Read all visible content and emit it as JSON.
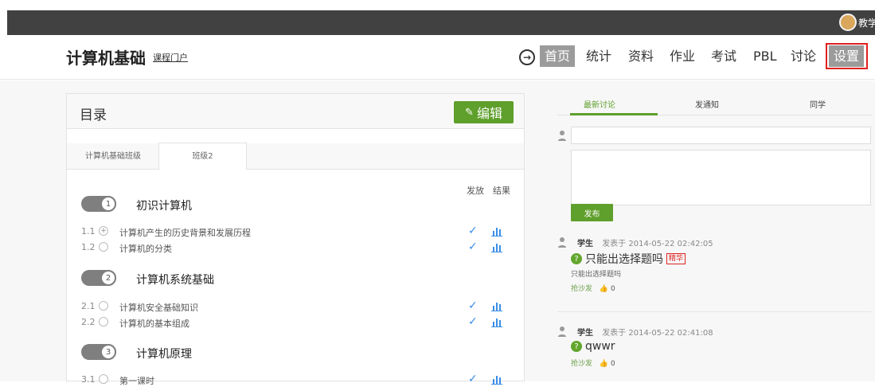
{
  "topbar": {
    "user": "教学"
  },
  "header": {
    "course_title": "计算机基础",
    "portal_link": "课程门户",
    "nav": [
      "首页",
      "统计",
      "资料",
      "作业",
      "考试",
      "PBL",
      "讨论",
      "设置"
    ]
  },
  "catalog": {
    "title": "目录",
    "edit_label": "编辑",
    "class_tabs": [
      "计算机基础班级",
      "班级2"
    ],
    "col_release": "发放",
    "col_result": "结果",
    "chapters": [
      {
        "number": "1",
        "title": "初识计算机",
        "sections": [
          {
            "no": "1.1",
            "title": "计算机产生的历史背景和发展历程",
            "circle": "+"
          },
          {
            "no": "1.2",
            "title": "计算机的分类",
            "circle": ""
          }
        ]
      },
      {
        "number": "2",
        "title": "计算机系统基础",
        "sections": [
          {
            "no": "2.1",
            "title": "计算机安全基础知识",
            "circle": ""
          },
          {
            "no": "2.2",
            "title": "计算机的基本组成",
            "circle": ""
          }
        ]
      },
      {
        "number": "3",
        "title": "计算机原理",
        "sections": [
          {
            "no": "3.1",
            "title": "第一课时",
            "circle": ""
          }
        ]
      }
    ]
  },
  "right": {
    "tabs": [
      "最新讨论",
      "发通知",
      "同学"
    ],
    "publish_label": "发布",
    "posts": [
      {
        "author": "学生",
        "time": "发表于 2014-05-22 02:42:05",
        "title": "只能出选择题吗",
        "badge": "精华",
        "body": "只能出选择题吗",
        "action": "抢沙发",
        "likes": "0"
      },
      {
        "author": "学生",
        "time": "发表于 2014-05-22 02:41:08",
        "title": "qwwr",
        "badge": "",
        "body": "",
        "action": "抢沙发",
        "likes": "0"
      }
    ]
  },
  "colors": {
    "accent_green": "#5f9f2b",
    "topbar": "#414141",
    "nav_active": "#9b9b9b",
    "highlight_red": "#e02020"
  }
}
